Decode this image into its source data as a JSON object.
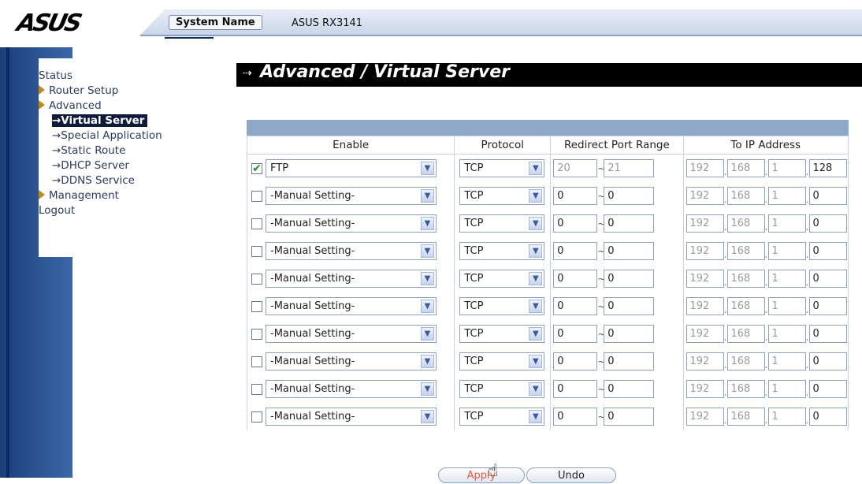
{
  "header": {
    "logo": "ASUS",
    "system_name_label": "System Name",
    "system_name_value": "ASUS RX3141"
  },
  "menu": {
    "items": [
      {
        "label": "Status",
        "type": "top",
        "arrow": false
      },
      {
        "label": "Router Setup",
        "type": "top",
        "arrow": true
      },
      {
        "label": "Advanced",
        "type": "top",
        "arrow": true
      },
      {
        "label": "→Virtual Server",
        "type": "sub",
        "active": true
      },
      {
        "label": "→Special Application",
        "type": "sub"
      },
      {
        "label": "→Static Route",
        "type": "sub"
      },
      {
        "label": "→DHCP Server",
        "type": "sub"
      },
      {
        "label": "→DDNS Service",
        "type": "sub"
      },
      {
        "label": "Management",
        "type": "top",
        "arrow": true
      },
      {
        "label": "Logout",
        "type": "top",
        "arrow": false
      }
    ]
  },
  "page": {
    "title_bullet": "⇢",
    "title": "Advanced / Virtual Server"
  },
  "table": {
    "headers": [
      "Enable",
      "Protocol",
      "Redirect Port Range",
      "To IP Address"
    ],
    "rows": [
      {
        "enabled": true,
        "service": "FTP",
        "protocol": "TCP",
        "port_from": "20",
        "port_to": "21",
        "ip": [
          "192",
          "168",
          "1",
          "128"
        ],
        "disabled_ports": true
      },
      {
        "enabled": false,
        "service": "-Manual Setting-",
        "protocol": "TCP",
        "port_from": "0",
        "port_to": "0",
        "ip": [
          "192",
          "168",
          "1",
          "0"
        ],
        "disabled_ports": false
      },
      {
        "enabled": false,
        "service": "-Manual Setting-",
        "protocol": "TCP",
        "port_from": "0",
        "port_to": "0",
        "ip": [
          "192",
          "168",
          "1",
          "0"
        ],
        "disabled_ports": false
      },
      {
        "enabled": false,
        "service": "-Manual Setting-",
        "protocol": "TCP",
        "port_from": "0",
        "port_to": "0",
        "ip": [
          "192",
          "168",
          "1",
          "0"
        ],
        "disabled_ports": false
      },
      {
        "enabled": false,
        "service": "-Manual Setting-",
        "protocol": "TCP",
        "port_from": "0",
        "port_to": "0",
        "ip": [
          "192",
          "168",
          "1",
          "0"
        ],
        "disabled_ports": false
      },
      {
        "enabled": false,
        "service": "-Manual Setting-",
        "protocol": "TCP",
        "port_from": "0",
        "port_to": "0",
        "ip": [
          "192",
          "168",
          "1",
          "0"
        ],
        "disabled_ports": false
      },
      {
        "enabled": false,
        "service": "-Manual Setting-",
        "protocol": "TCP",
        "port_from": "0",
        "port_to": "0",
        "ip": [
          "192",
          "168",
          "1",
          "0"
        ],
        "disabled_ports": false
      },
      {
        "enabled": false,
        "service": "-Manual Setting-",
        "protocol": "TCP",
        "port_from": "0",
        "port_to": "0",
        "ip": [
          "192",
          "168",
          "1",
          "0"
        ],
        "disabled_ports": false
      },
      {
        "enabled": false,
        "service": "-Manual Setting-",
        "protocol": "TCP",
        "port_from": "0",
        "port_to": "0",
        "ip": [
          "192",
          "168",
          "1",
          "0"
        ],
        "disabled_ports": false
      },
      {
        "enabled": false,
        "service": "-Manual Setting-",
        "protocol": "TCP",
        "port_from": "0",
        "port_to": "0",
        "ip": [
          "192",
          "168",
          "1",
          "0"
        ],
        "disabled_ports": false
      }
    ]
  },
  "buttons": {
    "apply": "Apply",
    "undo": "Undo"
  },
  "colors": {
    "accent": "#8fa8c8",
    "menu_active_bg": "#0d1a3a",
    "apply_text": "#e05a3a",
    "checkbox_check": "#2a8a2a"
  },
  "icons": {
    "check": "✔",
    "dropdown": "▼",
    "tilde": "~",
    "cursor": "☝"
  }
}
